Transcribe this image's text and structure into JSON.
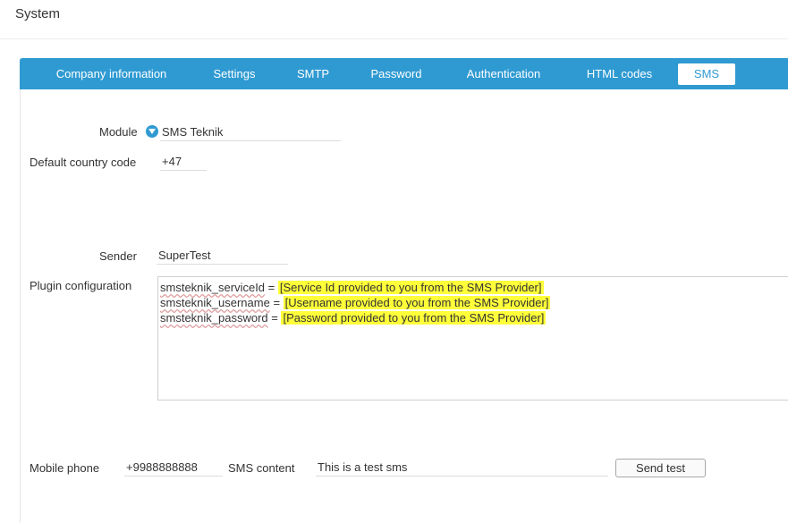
{
  "page": {
    "title": "System"
  },
  "tabs": [
    {
      "label": "Company information",
      "active": false
    },
    {
      "label": "Settings",
      "active": false
    },
    {
      "label": "SMTP",
      "active": false
    },
    {
      "label": "Password",
      "active": false
    },
    {
      "label": "Authentication",
      "active": false
    },
    {
      "label": "HTML codes",
      "active": false
    },
    {
      "label": "SMS",
      "active": true
    }
  ],
  "form": {
    "module_label": "Module",
    "module_value": "SMS Teknik",
    "country_label": "Default country code",
    "country_value": "+47",
    "sender_label": "Sender",
    "sender_value": "SuperTest",
    "plugin_label": "Plugin configuration",
    "plugin_lines": [
      {
        "key": "smsteknik_serviceId",
        "sep": " = ",
        "value": "[Service Id provided to you from the SMS Provider]"
      },
      {
        "key": "smsteknik_username",
        "sep": " = ",
        "value": "[Username provided to you from the SMS Provider]"
      },
      {
        "key": "smsteknik_password",
        "sep": " = ",
        "value": "[Password provided to you from the SMS Provider]"
      }
    ],
    "mobile_label": "Mobile phone",
    "mobile_value": "+9988888888",
    "content_label": "SMS content",
    "content_value": "This is a test sms",
    "send_test_label": "Send test"
  },
  "colors": {
    "accent": "#2f9ad2",
    "highlight": "#ffff3a"
  }
}
